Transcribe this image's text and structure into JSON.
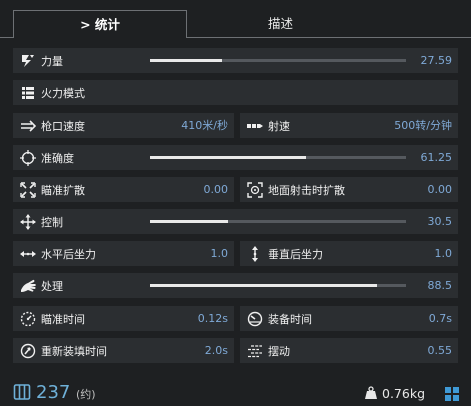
{
  "tabs": {
    "stats": "> 统计",
    "description": "描述"
  },
  "stats": {
    "power": {
      "label": "力量",
      "value": "27.59",
      "fill": 0.28
    },
    "fire_mode": {
      "label": "火力模式"
    },
    "muzzle_velocity": {
      "label": "枪口速度",
      "value": "410米/秒"
    },
    "fire_rate": {
      "label": "射速",
      "value": "500转/分钟"
    },
    "accuracy": {
      "label": "准确度",
      "value": "61.25",
      "fill": 0.61
    },
    "aim_spread": {
      "label": "瞄准扩散",
      "value": "0.00"
    },
    "hipfire_spread": {
      "label": "地面射击时扩散",
      "value": "0.00"
    },
    "control": {
      "label": "控制",
      "value": "30.5",
      "fill": 0.305
    },
    "horizontal_recoil": {
      "label": "水平后坐力",
      "value": "1.0"
    },
    "vertical_recoil": {
      "label": "垂直后坐力",
      "value": "1.0"
    },
    "handling": {
      "label": "处理",
      "value": "88.5",
      "fill": 0.885
    },
    "aim_time": {
      "label": "瞄准时间",
      "value": "0.12s"
    },
    "equip_time": {
      "label": "装备时间",
      "value": "0.7s"
    },
    "reload_time": {
      "label": "重新装填时间",
      "value": "2.0s"
    },
    "sway": {
      "label": "摆动",
      "value": "0.55"
    }
  },
  "footer": {
    "credits": "237",
    "credits_note": "(约)",
    "weight": "0.76kg"
  },
  "colors": {
    "value_blue": "#7fa9d6",
    "credits_blue": "#6fb1d9",
    "bar_track": "#55595e",
    "bar_fill": "#e9e9e9"
  }
}
